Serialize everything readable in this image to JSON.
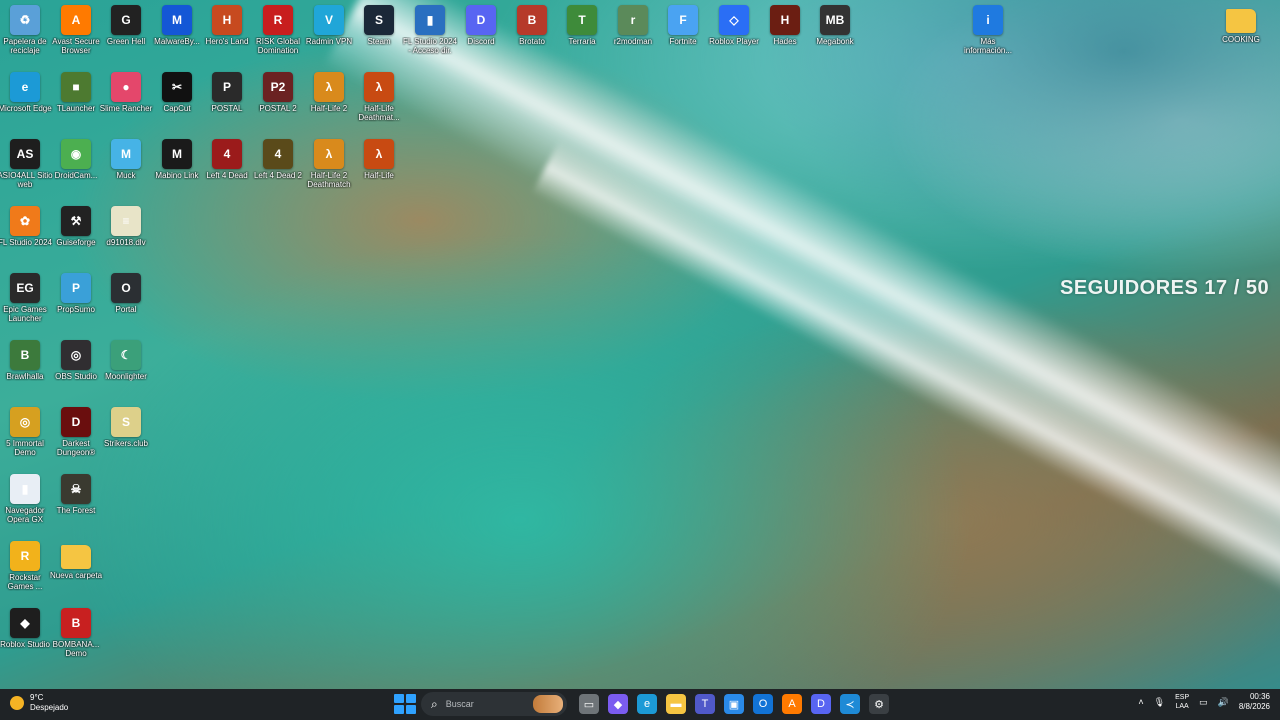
{
  "desktop": {
    "overlay_text": "SEGUIDORES 17 / 50",
    "icons": [
      {
        "label": "Papelera de reciclaje",
        "icon": "recycle-bin-icon",
        "color": "#5aa0d8",
        "glyph": "♻"
      },
      {
        "label": "Avast Secure Browser",
        "icon": "avast-browser-icon",
        "color": "#ff7a00",
        "glyph": "A"
      },
      {
        "label": "Green Hell",
        "icon": "green-hell-icon",
        "color": "#222222",
        "glyph": "G"
      },
      {
        "label": "MalwareBy...",
        "icon": "malwarebytes-icon",
        "color": "#1457d6",
        "glyph": "M"
      },
      {
        "label": "Hero's Land",
        "icon": "heros-land-icon",
        "color": "#c74a1f",
        "glyph": "H"
      },
      {
        "label": "RISK Global Domination",
        "icon": "risk-icon",
        "color": "#c81e1e",
        "glyph": "R"
      },
      {
        "label": "Radmin VPN",
        "icon": "radmin-vpn-icon",
        "color": "#20a6d8",
        "glyph": "V"
      },
      {
        "label": "Steam",
        "icon": "steam-icon",
        "color": "#1b2838",
        "glyph": "S"
      },
      {
        "label": "FL Studio 2024 - Acceso dir.",
        "icon": "fl-shortcut-icon",
        "color": "#2a6fc0",
        "glyph": "▮"
      },
      {
        "label": "Discord",
        "icon": "discord-icon",
        "color": "#5865f2",
        "glyph": "D"
      },
      {
        "label": "Brotato",
        "icon": "brotato-icon",
        "color": "#b63a2a",
        "glyph": "B"
      },
      {
        "label": "Terraria",
        "icon": "terraria-icon",
        "color": "#3e8b3a",
        "glyph": "T"
      },
      {
        "label": "r2modman",
        "icon": "r2modman-icon",
        "color": "#5b8a5a",
        "glyph": "r"
      },
      {
        "label": "Fortnite",
        "icon": "fortnite-icon",
        "color": "#4aa3f2",
        "glyph": "F"
      },
      {
        "label": "Roblox Player",
        "icon": "roblox-player-icon",
        "color": "#2a6ef5",
        "glyph": "◇"
      },
      {
        "label": "Hades",
        "icon": "hades-icon",
        "color": "#6b1e12",
        "glyph": "H"
      },
      {
        "label": "Megabonk",
        "icon": "megabonk-icon",
        "color": "#333333",
        "glyph": "MB"
      },
      {
        "label": "Más información...",
        "icon": "more-info-icon",
        "color": "#1f7ae0",
        "glyph": "i"
      },
      {
        "label": "COOKING",
        "icon": "folder-icon",
        "color": "#f5c542",
        "glyph": ""
      },
      {
        "label": "Microsoft Edge",
        "icon": "edge-icon",
        "color": "#1c9ad6",
        "glyph": "e"
      },
      {
        "label": "TLauncher",
        "icon": "tlauncher-icon",
        "color": "#4d7a30",
        "glyph": "■"
      },
      {
        "label": "Slime Rancher",
        "icon": "slime-rancher-icon",
        "color": "#e4476b",
        "glyph": "●"
      },
      {
        "label": "CapCut",
        "icon": "capcut-icon",
        "color": "#111111",
        "glyph": "✂"
      },
      {
        "label": "POSTAL",
        "icon": "postal-icon",
        "color": "#2a2a2a",
        "glyph": "P"
      },
      {
        "label": "POSTAL 2",
        "icon": "postal2-icon",
        "color": "#6b2222",
        "glyph": "P2"
      },
      {
        "label": "Half-Life 2",
        "icon": "half-life-2-icon",
        "color": "#d98a1c",
        "glyph": "λ"
      },
      {
        "label": "Half-Life Deathmat...",
        "icon": "half-life-deathmatch-icon",
        "color": "#c84a12",
        "glyph": "λ"
      },
      {
        "label": "ASIO4ALL Sitio web",
        "icon": "asio4all-icon",
        "color": "#1e1e1e",
        "glyph": "AS"
      },
      {
        "label": "DroidCam...",
        "icon": "droidcam-icon",
        "color": "#4caf50",
        "glyph": "◉"
      },
      {
        "label": "Muck",
        "icon": "muck-icon",
        "color": "#46b3e6",
        "glyph": "M"
      },
      {
        "label": "Mabino Link",
        "icon": "mabino-link-icon",
        "color": "#1a1a1a",
        "glyph": "M"
      },
      {
        "label": "Left 4 Dead",
        "icon": "left4dead-icon",
        "color": "#9b1b1b",
        "glyph": "4"
      },
      {
        "label": "Left 4 Dead 2",
        "icon": "left4dead2-icon",
        "color": "#5a4a1a",
        "glyph": "4"
      },
      {
        "label": "Half-Life 2 Deathmatch",
        "icon": "half-life-2-deathmatch-icon",
        "color": "#d98a1c",
        "glyph": "λ"
      },
      {
        "label": "Half-Life",
        "icon": "half-life-icon",
        "color": "#c84a12",
        "glyph": "λ"
      },
      {
        "label": "FL Studio 2024",
        "icon": "fl-studio-icon",
        "color": "#f07a1a",
        "glyph": "✿"
      },
      {
        "label": "Guiseforge",
        "icon": "guiseforge-icon",
        "color": "#222222",
        "glyph": "⚒"
      },
      {
        "label": "d91018.dlv",
        "icon": "file-icon",
        "color": "#e8e4c8",
        "glyph": "≡"
      },
      {
        "label": "Epic Games Launcher",
        "icon": "epic-games-icon",
        "color": "#2a2a2a",
        "glyph": "EG"
      },
      {
        "label": "PropSumo",
        "icon": "propsumo-icon",
        "color": "#3aa0d8",
        "glyph": "P"
      },
      {
        "label": "Portal",
        "icon": "portal-icon",
        "color": "#2b2f33",
        "glyph": "O"
      },
      {
        "label": "Brawlhalla",
        "icon": "brawlhalla-icon",
        "color": "#3c7a3c",
        "glyph": "B"
      },
      {
        "label": "OBS Studio",
        "icon": "obs-icon",
        "color": "#302e31",
        "glyph": "◎"
      },
      {
        "label": "Moonlighter",
        "icon": "moonlighter-icon",
        "color": "#3ba07a",
        "glyph": "☾"
      },
      {
        "label": "5 Immortal Demo",
        "icon": "immortal-demo-icon",
        "color": "#d6a020",
        "glyph": "◎"
      },
      {
        "label": "Darkest Dungeon®",
        "icon": "darkest-dungeon-icon",
        "color": "#6a0e0e",
        "glyph": "D"
      },
      {
        "label": "Strikers.club",
        "icon": "strikers-club-icon",
        "color": "#ddd08a",
        "glyph": "S"
      },
      {
        "label": "Navegador Opera GX",
        "icon": "opera-gx-icon",
        "color": "#e8eef5",
        "glyph": "▮"
      },
      {
        "label": "The Forest",
        "icon": "the-forest-icon",
        "color": "#3a3a30",
        "glyph": "☠"
      },
      {
        "label": "Rockstar Games ...",
        "icon": "rockstar-icon",
        "color": "#f2b21b",
        "glyph": "R"
      },
      {
        "label": "Nueva carpeta",
        "icon": "new-folder-icon",
        "color": "#f5c542",
        "glyph": ""
      },
      {
        "label": "Roblox Studio",
        "icon": "roblox-studio-icon",
        "color": "#1e1e1e",
        "glyph": "◆"
      },
      {
        "label": "BOMBANA... Demo",
        "icon": "bombana-demo-icon",
        "color": "#c82020",
        "glyph": "B"
      }
    ]
  },
  "taskbar": {
    "weather_temp": "9°C",
    "weather_desc": "Despejado",
    "search_placeholder": "Buscar",
    "apps": [
      {
        "icon": "file-explorer-gray-icon",
        "color": "#6e7478",
        "glyph": "▭"
      },
      {
        "icon": "copilot-icon",
        "color": "#7b5cf0",
        "glyph": "◆"
      },
      {
        "icon": "edge-taskbar-icon",
        "color": "#1c9ad6",
        "glyph": "e"
      },
      {
        "icon": "file-explorer-icon",
        "color": "#f5c542",
        "glyph": "▬"
      },
      {
        "icon": "teams-icon",
        "color": "#5059c9",
        "glyph": "T"
      },
      {
        "icon": "store-icon",
        "color": "#2a8ae8",
        "glyph": "▣"
      },
      {
        "icon": "outlook-icon",
        "color": "#1273d6",
        "glyph": "O"
      },
      {
        "icon": "avast-taskbar-icon",
        "color": "#ff7a00",
        "glyph": "A"
      },
      {
        "icon": "discord-taskbar-icon",
        "color": "#5865f2",
        "glyph": "D"
      },
      {
        "icon": "vscode-icon",
        "color": "#1e8ad6",
        "glyph": "≺"
      },
      {
        "icon": "settings-icon",
        "color": "#3a3f43",
        "glyph": "⚙"
      }
    ],
    "language_top": "ESP",
    "language_bottom": "LAA",
    "time": "00:36",
    "date": "8/8/2026"
  }
}
